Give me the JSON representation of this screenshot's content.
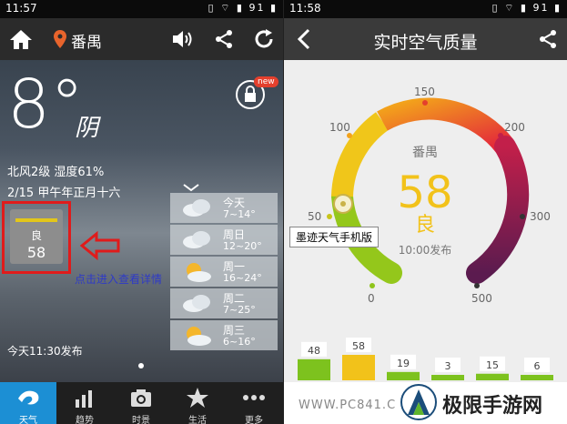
{
  "left": {
    "status_time": "11:57",
    "status_icons": "▯ ⌔ ▮ 91 ▮",
    "city": "番禺",
    "temperature": "8°",
    "condition": "阴",
    "wind_humidity": "北风2级 湿度61%",
    "date": "2/15 甲午年正月十六",
    "aqi_label": "良",
    "aqi_value": "58",
    "tip": "点击进入查看详情",
    "published": "今天11:30发布",
    "badge_new": "new",
    "forecast": [
      {
        "day": "今天",
        "temp": "7~14°"
      },
      {
        "day": "周日",
        "temp": "12~20°"
      },
      {
        "day": "周一",
        "temp": "16~24°"
      },
      {
        "day": "周二",
        "temp": "7~25°"
      },
      {
        "day": "周三",
        "temp": "6~16°"
      }
    ],
    "nav": [
      "天气",
      "趋势",
      "时景",
      "生活",
      "更多"
    ]
  },
  "right": {
    "status_time": "11:58",
    "status_icons": "▯ ⌔ ▮ 91 ▮",
    "title": "实时空气质量",
    "city": "番禺",
    "value": "58",
    "level": "良",
    "published": "10:00发布",
    "scale": {
      "s0": "0",
      "s50": "50",
      "s100": "100",
      "s150": "150",
      "s200": "200",
      "s300": "300",
      "s500": "500"
    },
    "watermark": "墨迹天气手机版",
    "site": "WWW.PC841.C",
    "brand": "极限手游网"
  },
  "chart_data": {
    "type": "bar",
    "categories": [
      "",
      "",
      "",
      "",
      "",
      ""
    ],
    "values": [
      48,
      58,
      19,
      3,
      15,
      6
    ],
    "colors": [
      "#7dc21e",
      "#f2c21a",
      "#7dc21e",
      "#7dc21e",
      "#7dc21e",
      "#7dc21e"
    ]
  },
  "colors": {
    "accent": "#1c8fd4",
    "aqi_good": "#f2c21a",
    "alert": "#e01b1b",
    "tip": "#2e3ac7"
  }
}
